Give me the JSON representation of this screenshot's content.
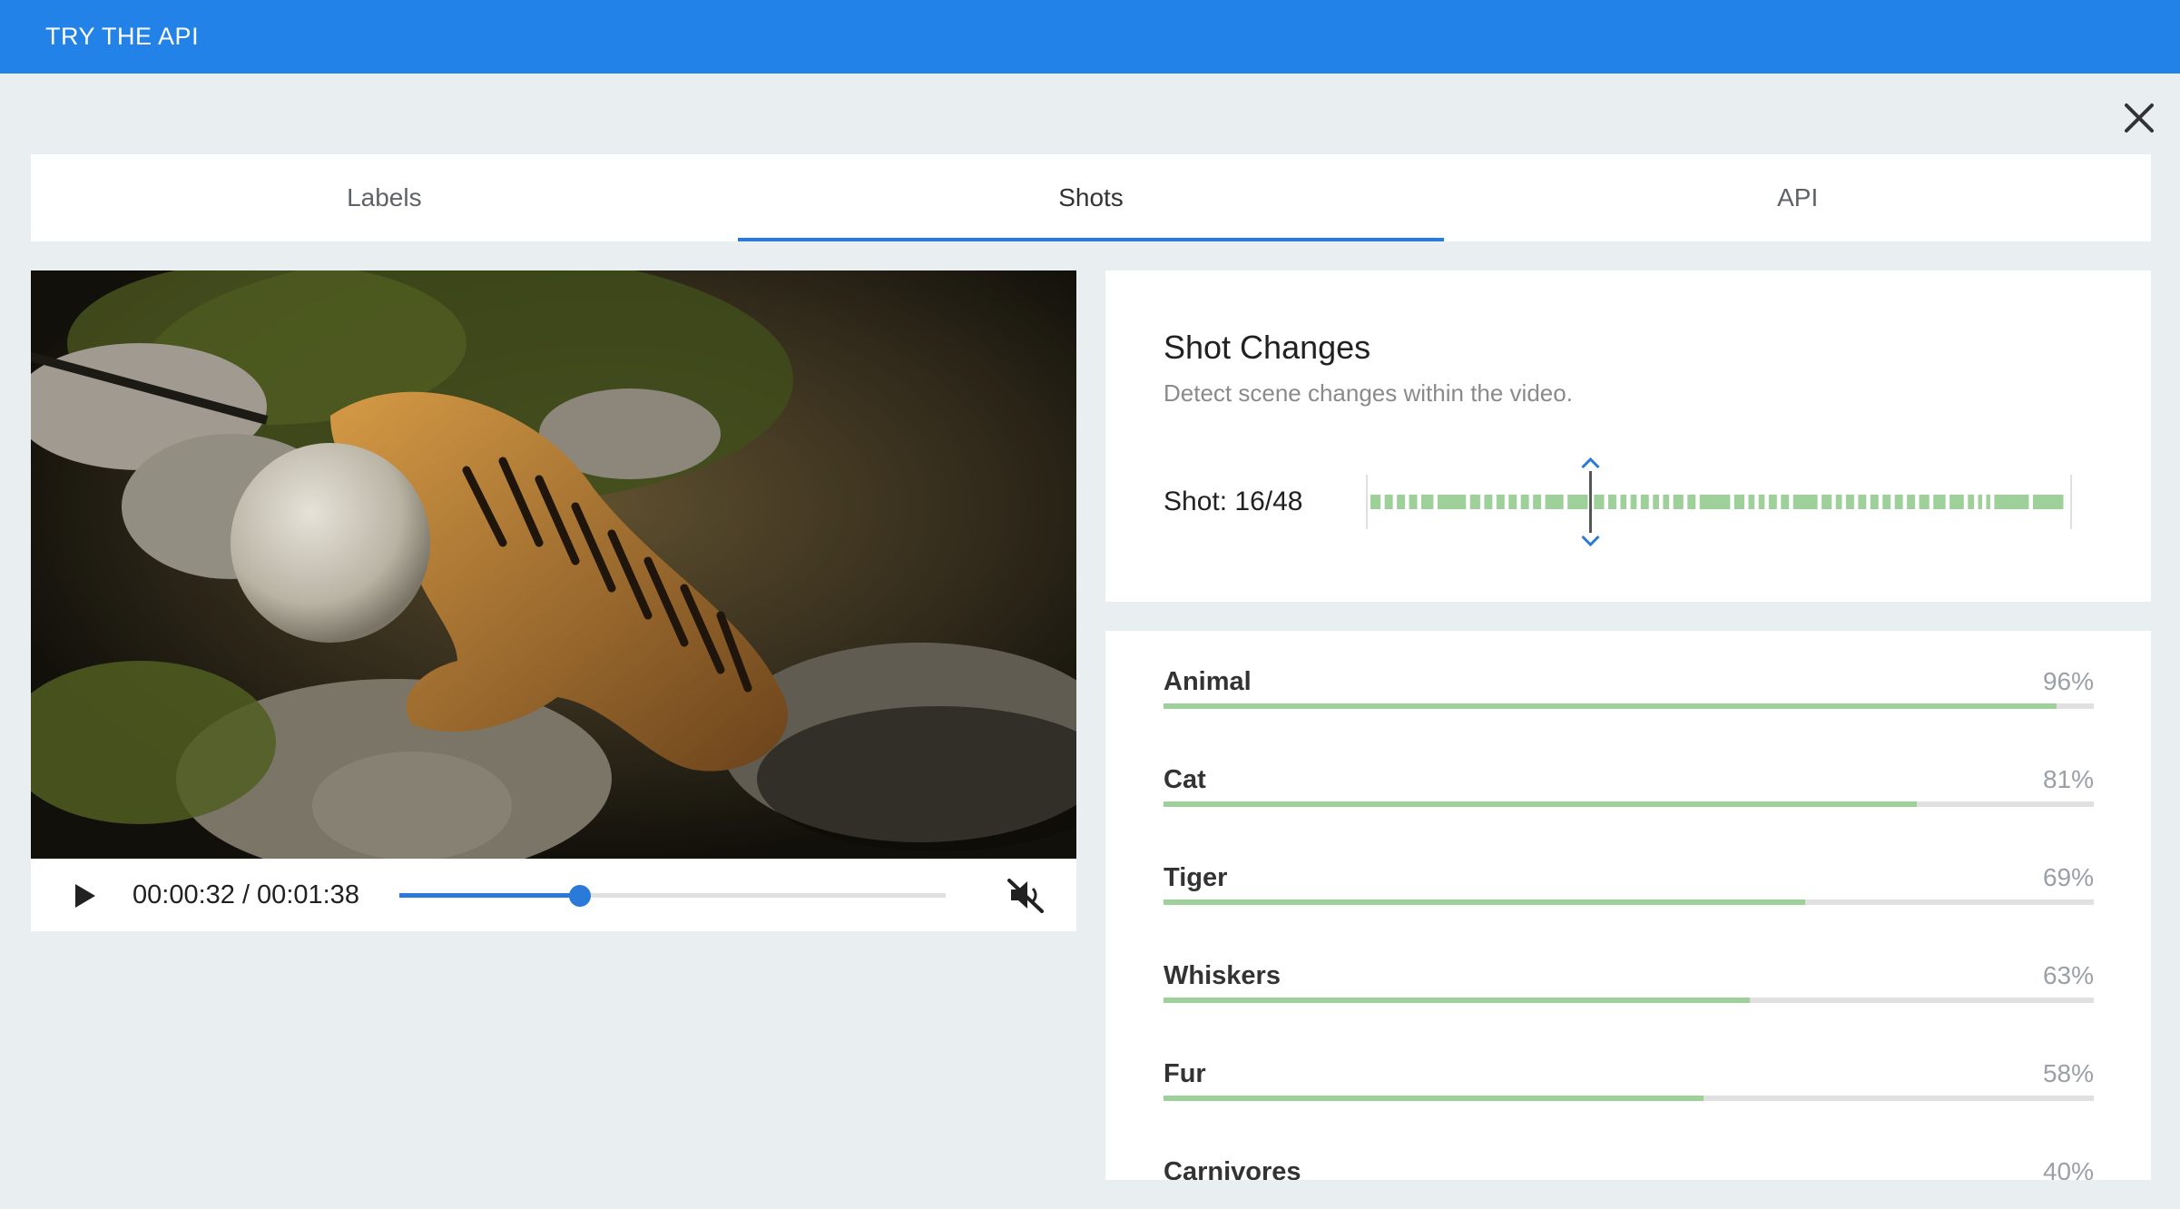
{
  "header": {
    "title": "TRY THE API"
  },
  "tabs": [
    {
      "label": "Labels",
      "active": false
    },
    {
      "label": "Shots",
      "active": true
    },
    {
      "label": "API",
      "active": false
    }
  ],
  "player": {
    "time_text": "00:00:32 / 00:01:38",
    "progress": 0.33,
    "muted": true
  },
  "shots": {
    "title": "Shot Changes",
    "description": "Detect scene changes within the video.",
    "count_text": "Shot: 16/48",
    "current": 16,
    "total": 48
  },
  "labels": [
    {
      "name": "Animal",
      "percent_text": "96%",
      "value": 0.96
    },
    {
      "name": "Cat",
      "percent_text": "81%",
      "value": 0.81
    },
    {
      "name": "Tiger",
      "percent_text": "69%",
      "value": 0.69
    },
    {
      "name": "Whiskers",
      "percent_text": "63%",
      "value": 0.63
    },
    {
      "name": "Fur",
      "percent_text": "58%",
      "value": 0.58
    },
    {
      "name": "Carnivores",
      "percent_text": "40%",
      "value": 0.4
    }
  ],
  "colors": {
    "header_blue": "#2382e8",
    "accent_blue": "#2a7ad9",
    "bar_green": "#9ed19a"
  },
  "icons": {
    "close": "close-icon",
    "play": "play-icon",
    "mute": "volume-off-icon"
  }
}
